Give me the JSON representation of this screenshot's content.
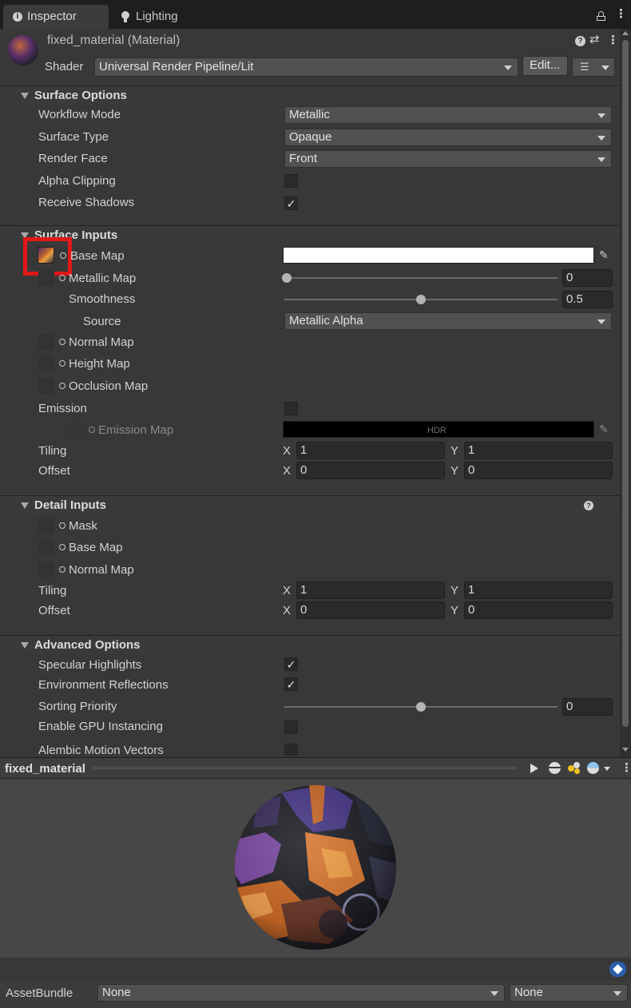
{
  "tabs": {
    "inspector": "Inspector",
    "lighting": "Lighting"
  },
  "header": {
    "title": "fixed_material (Material)",
    "shader_label": "Shader",
    "shader_value": "Universal Render Pipeline/Lit",
    "edit_button": "Edit..."
  },
  "surface_options": {
    "title": "Surface Options",
    "workflow_mode": {
      "label": "Workflow Mode",
      "value": "Metallic"
    },
    "surface_type": {
      "label": "Surface Type",
      "value": "Opaque"
    },
    "render_face": {
      "label": "Render Face",
      "value": "Front"
    },
    "alpha_clipping": {
      "label": "Alpha Clipping",
      "checked": false
    },
    "receive_shadows": {
      "label": "Receive Shadows",
      "checked": true
    }
  },
  "surface_inputs": {
    "title": "Surface Inputs",
    "base_map": {
      "label": "Base Map"
    },
    "metallic_map": {
      "label": "Metallic Map",
      "value": "0",
      "slider": 0
    },
    "smoothness": {
      "label": "Smoothness",
      "value": "0.5",
      "slider": 0.5
    },
    "source": {
      "label": "Source",
      "value": "Metallic Alpha"
    },
    "normal_map": {
      "label": "Normal Map"
    },
    "height_map": {
      "label": "Height Map"
    },
    "occlusion_map": {
      "label": "Occlusion Map"
    },
    "emission": {
      "label": "Emission",
      "checked": false
    },
    "emission_map": {
      "label": "Emission Map",
      "hdr": "HDR"
    },
    "tiling": {
      "label": "Tiling",
      "x_label": "X",
      "x": "1",
      "y_label": "Y",
      "y": "1"
    },
    "offset": {
      "label": "Offset",
      "x_label": "X",
      "x": "0",
      "y_label": "Y",
      "y": "0"
    }
  },
  "detail_inputs": {
    "title": "Detail Inputs",
    "mask": {
      "label": "Mask"
    },
    "base_map": {
      "label": "Base Map"
    },
    "normal_map": {
      "label": "Normal Map"
    },
    "tiling": {
      "label": "Tiling",
      "x_label": "X",
      "x": "1",
      "y_label": "Y",
      "y": "1"
    },
    "offset": {
      "label": "Offset",
      "x_label": "X",
      "x": "0",
      "y_label": "Y",
      "y": "0"
    }
  },
  "advanced_options": {
    "title": "Advanced Options",
    "specular_highlights": {
      "label": "Specular Highlights",
      "checked": true
    },
    "environment_reflections": {
      "label": "Environment Reflections",
      "checked": true
    },
    "sorting_priority": {
      "label": "Sorting Priority",
      "value": "0",
      "slider": 0.5
    },
    "gpu_instancing": {
      "label": "Enable GPU Instancing",
      "checked": false
    },
    "alembic_motion_vectors": {
      "label": "Alembic Motion Vectors",
      "checked": false
    }
  },
  "preview": {
    "title": "fixed_material"
  },
  "asset_bundle": {
    "label": "AssetBundle",
    "name_value": "None",
    "variant_value": "None"
  },
  "colors": {
    "base_map_color": "#ffffff",
    "emission_color": "#000000",
    "highlight_box": "#e01818",
    "panel_bg": "#383838",
    "tab_active": "#3c3c3c"
  }
}
